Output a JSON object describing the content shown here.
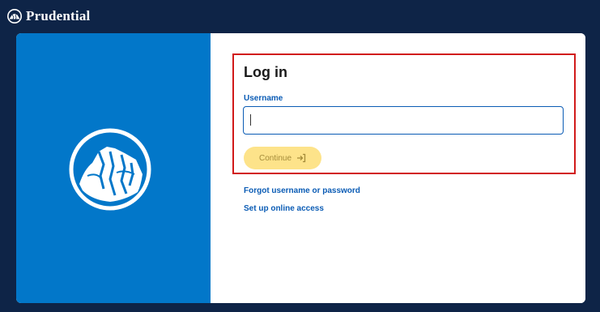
{
  "header": {
    "brand_name": "Prudential",
    "brand_icon": "prudential-rock-icon"
  },
  "login": {
    "title": "Log in",
    "username_label": "Username",
    "username_value": "",
    "continue_label": "Continue",
    "continue_icon": "login-arrow-icon"
  },
  "links": {
    "forgot": "Forgot username or password",
    "setup": "Set up online access"
  },
  "colors": {
    "page_background": "#0e2447",
    "left_panel": "#0277c9",
    "link_blue": "#0b5cb5",
    "continue_button": "#fde38a",
    "highlight_border": "#d11a1a"
  }
}
